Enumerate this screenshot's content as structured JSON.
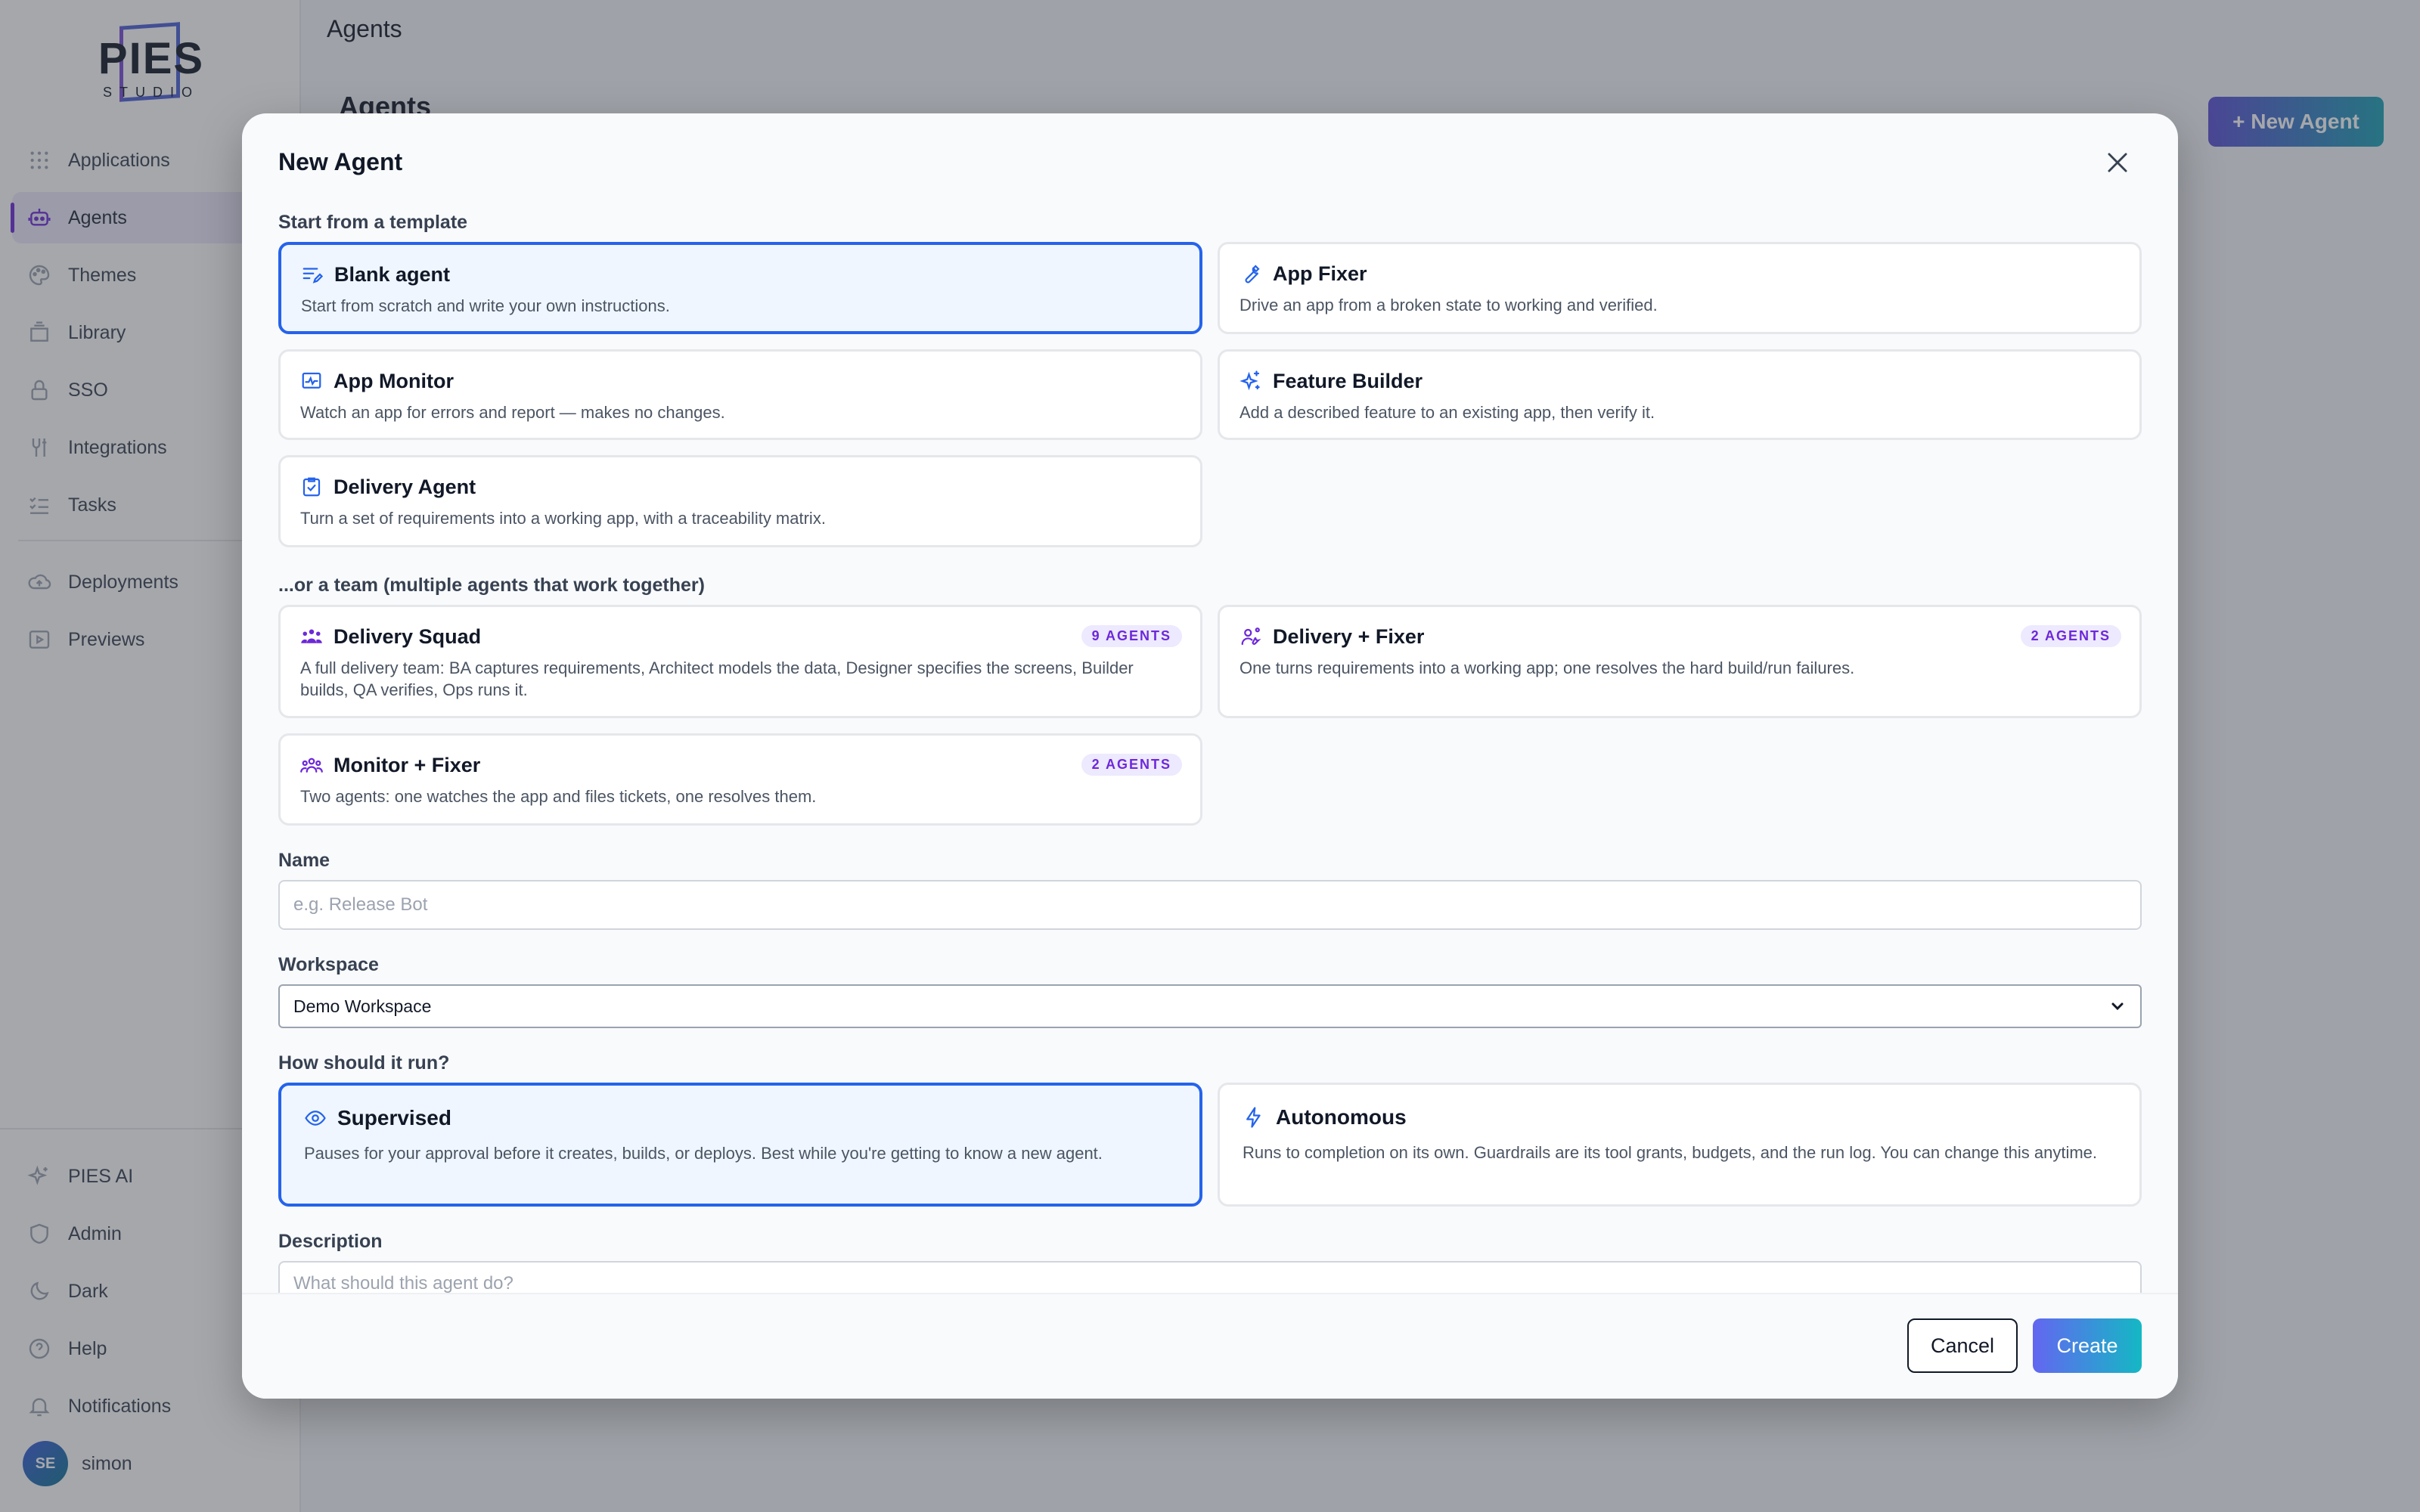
{
  "app": {
    "logo_text": "PIES",
    "logo_sub": "STUDIO",
    "topbar_title": "Agents",
    "page_title": "Agents",
    "new_agent_label": "+ New Agent"
  },
  "sidebar": {
    "items": [
      {
        "label": "Applications",
        "icon": "grid-icon"
      },
      {
        "label": "Agents",
        "icon": "robot-icon",
        "active": true
      },
      {
        "label": "Themes",
        "icon": "palette-icon"
      },
      {
        "label": "Library",
        "icon": "library-icon"
      },
      {
        "label": "SSO",
        "icon": "lock-icon"
      },
      {
        "label": "Integrations",
        "icon": "plug-icon"
      },
      {
        "label": "Tasks",
        "icon": "checklist-icon"
      },
      {
        "label": "Deployments",
        "icon": "cloud-upload-icon"
      },
      {
        "label": "Previews",
        "icon": "play-icon"
      }
    ],
    "bottom": [
      {
        "label": "PIES AI",
        "icon": "sparkle-icon"
      },
      {
        "label": "Admin",
        "icon": "shield-icon"
      },
      {
        "label": "Dark",
        "icon": "moon-icon"
      },
      {
        "label": "Help",
        "icon": "help-icon"
      },
      {
        "label": "Notifications",
        "icon": "bell-icon"
      }
    ],
    "user": {
      "initials": "SE",
      "name": "simon"
    }
  },
  "modal": {
    "title": "New Agent",
    "template_section": "Start from a template",
    "templates": [
      {
        "title": "Blank agent",
        "desc": "Start from scratch and write your own instructions.",
        "icon": "edit-lines-icon",
        "selected": true
      },
      {
        "title": "App Fixer",
        "desc": "Drive an app from a broken state to working and verified.",
        "icon": "wrench-icon"
      },
      {
        "title": "App Monitor",
        "desc": "Watch an app for errors and report — makes no changes.",
        "icon": "monitor-chart-icon"
      },
      {
        "title": "Feature Builder",
        "desc": "Add a described feature to an existing app, then verify it.",
        "icon": "sparkle-icon"
      },
      {
        "title": "Delivery Agent",
        "desc": "Turn a set of requirements into a working app, with a traceability matrix.",
        "icon": "clipboard-check-icon"
      }
    ],
    "team_section": "...or a team (multiple agents that work together)",
    "teams": [
      {
        "title": "Delivery Squad",
        "badge": "9 AGENTS",
        "desc": "A full delivery team: BA captures requirements, Architect models the data, Designer specifies the screens, Builder builds, QA verifies, Ops runs it.",
        "icon": "group-icon"
      },
      {
        "title": "Delivery + Fixer",
        "badge": "2 AGENTS",
        "desc": "One turns requirements into a working app; one resolves the hard build/run failures.",
        "icon": "user-wrench-icon"
      },
      {
        "title": "Monitor + Fixer",
        "badge": "2 AGENTS",
        "desc": "Two agents: one watches the app and files tickets, one resolves them.",
        "icon": "team-icon"
      }
    ],
    "name_label": "Name",
    "name_placeholder": "e.g. Release Bot",
    "name_value": "",
    "workspace_label": "Workspace",
    "workspace_value": "Demo Workspace",
    "run_label": "How should it run?",
    "run_modes": [
      {
        "title": "Supervised",
        "desc": "Pauses for your approval before it creates, builds, or deploys. Best while you're getting to know a new agent.",
        "icon": "eye-icon",
        "selected": true
      },
      {
        "title": "Autonomous",
        "desc": "Runs to completion on its own. Guardrails are its tool grants, budgets, and the run log. You can change this anytime.",
        "icon": "bolt-icon"
      }
    ],
    "description_label": "Description",
    "description_placeholder": "What should this agent do?",
    "cancel_label": "Cancel",
    "create_label": "Create"
  },
  "colors": {
    "accent": "#2563eb",
    "brand_purple": "#6d28d9",
    "selected_bg": "#eff6ff"
  }
}
